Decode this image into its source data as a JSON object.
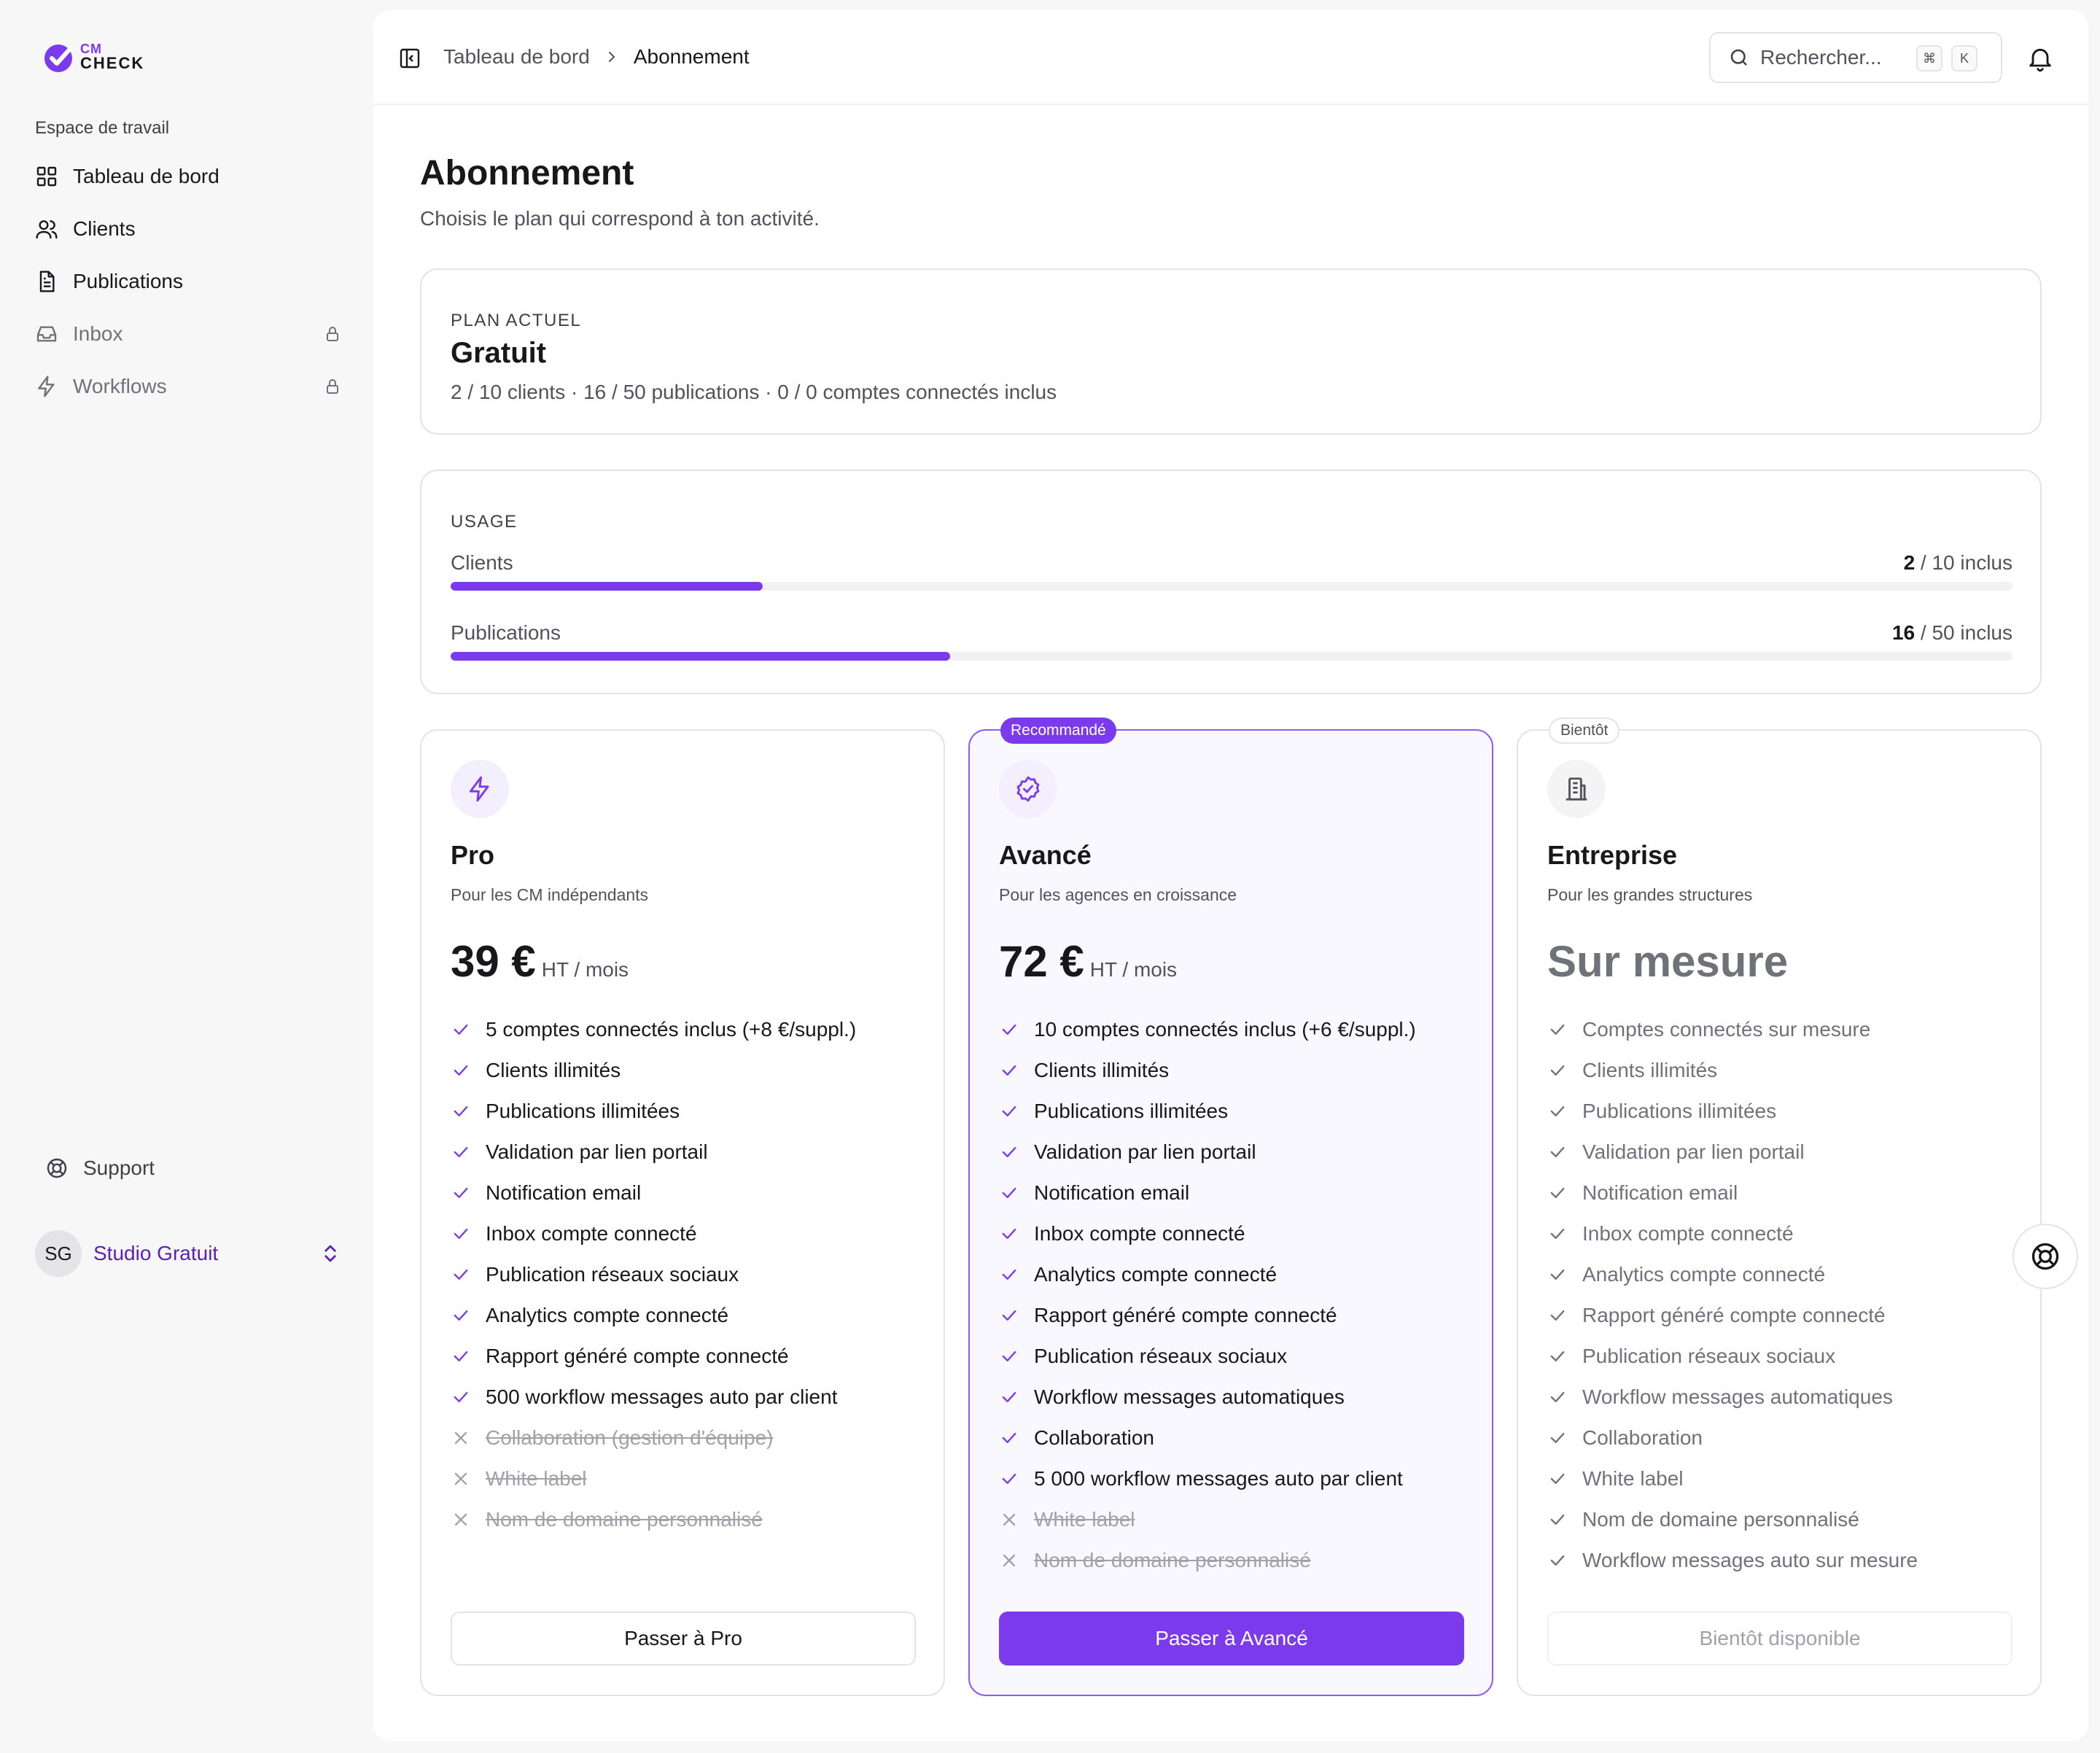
{
  "brand": {
    "line1": "CM",
    "line2": "CHECK",
    "accent": "#7c3aed"
  },
  "sidebar": {
    "section_label": "Espace de travail",
    "items": [
      {
        "label": "Tableau de bord",
        "icon": "dashboard-icon",
        "locked": false
      },
      {
        "label": "Clients",
        "icon": "users-icon",
        "locked": false
      },
      {
        "label": "Publications",
        "icon": "document-icon",
        "locked": false
      },
      {
        "label": "Inbox",
        "icon": "inbox-icon",
        "locked": true
      },
      {
        "label": "Workflows",
        "icon": "lightning-icon",
        "locked": true
      }
    ],
    "support_label": "Support",
    "account": {
      "initials": "SG",
      "name": "Studio Gratuit"
    }
  },
  "topbar": {
    "breadcrumb": [
      "Tableau de bord",
      "Abonnement"
    ],
    "search_placeholder": "Rechercher...",
    "shortcut_keys": [
      "⌘",
      "K"
    ]
  },
  "page": {
    "title": "Abonnement",
    "subtitle": "Choisis le plan qui correspond à ton activité."
  },
  "current_plan": {
    "eyebrow": "PLAN ACTUEL",
    "name": "Gratuit",
    "stats": "2 / 10 clients · 16 / 50 publications · 0 / 0 comptes connectés inclus"
  },
  "usage": {
    "eyebrow": "USAGE",
    "rows": [
      {
        "label": "Clients",
        "used": "2",
        "total_text": " / 10 inclus",
        "fraction": 0.2
      },
      {
        "label": "Publications",
        "used": "16",
        "total_text": " / 50 inclus",
        "fraction": 0.32
      }
    ]
  },
  "plans": [
    {
      "name": "Pro",
      "description": "Pour les CM indépendants",
      "price": "39 €",
      "period": "HT / mois",
      "badge": "",
      "icon": "lightning-icon",
      "features": [
        {
          "text": "5 comptes connectés inclus (+8 €/suppl.)",
          "included": true
        },
        {
          "text": "Clients illimités",
          "included": true
        },
        {
          "text": "Publications illimitées",
          "included": true
        },
        {
          "text": "Validation par lien portail",
          "included": true
        },
        {
          "text": "Notification email",
          "included": true
        },
        {
          "text": "Inbox compte connecté",
          "included": true
        },
        {
          "text": "Publication réseaux sociaux",
          "included": true
        },
        {
          "text": "Analytics compte connecté",
          "included": true
        },
        {
          "text": "Rapport généré compte connecté",
          "included": true
        },
        {
          "text": "500 workflow messages auto par client",
          "included": true
        },
        {
          "text": "Collaboration (gestion d'équipe)",
          "included": false
        },
        {
          "text": "White label",
          "included": false
        },
        {
          "text": "Nom de domaine personnalisé",
          "included": false
        }
      ],
      "cta": "Passer à Pro"
    },
    {
      "name": "Avancé",
      "description": "Pour les agences en croissance",
      "price": "72 €",
      "period": "HT / mois",
      "badge": "Recommandé",
      "icon": "badge-check-icon",
      "features": [
        {
          "text": "10 comptes connectés inclus (+6 €/suppl.)",
          "included": true
        },
        {
          "text": "Clients illimités",
          "included": true
        },
        {
          "text": "Publications illimitées",
          "included": true
        },
        {
          "text": "Validation par lien portail",
          "included": true
        },
        {
          "text": "Notification email",
          "included": true
        },
        {
          "text": "Inbox compte connecté",
          "included": true
        },
        {
          "text": "Analytics compte connecté",
          "included": true
        },
        {
          "text": "Rapport généré compte connecté",
          "included": true
        },
        {
          "text": "Publication réseaux sociaux",
          "included": true
        },
        {
          "text": "Workflow messages automatiques",
          "included": true
        },
        {
          "text": "Collaboration",
          "included": true
        },
        {
          "text": "5 000 workflow messages auto par client",
          "included": true
        },
        {
          "text": "White label",
          "included": false
        },
        {
          "text": "Nom de domaine personnalisé",
          "included": false
        }
      ],
      "cta": "Passer à Avancé"
    },
    {
      "name": "Entreprise",
      "description": "Pour les grandes structures",
      "price": "Sur mesure",
      "period": "",
      "badge": "Bientôt",
      "icon": "building-icon",
      "features": [
        {
          "text": "Comptes connectés sur mesure",
          "included": true
        },
        {
          "text": "Clients illimités",
          "included": true
        },
        {
          "text": "Publications illimitées",
          "included": true
        },
        {
          "text": "Validation par lien portail",
          "included": true
        },
        {
          "text": "Notification email",
          "included": true
        },
        {
          "text": "Inbox compte connecté",
          "included": true
        },
        {
          "text": "Analytics compte connecté",
          "included": true
        },
        {
          "text": "Rapport généré compte connecté",
          "included": true
        },
        {
          "text": "Publication réseaux sociaux",
          "included": true
        },
        {
          "text": "Workflow messages automatiques",
          "included": true
        },
        {
          "text": "Collaboration",
          "included": true
        },
        {
          "text": "White label",
          "included": true
        },
        {
          "text": "Nom de domaine personnalisé",
          "included": true
        },
        {
          "text": "Workflow messages auto sur mesure",
          "included": true
        }
      ],
      "cta": "Bientôt disponible"
    }
  ]
}
